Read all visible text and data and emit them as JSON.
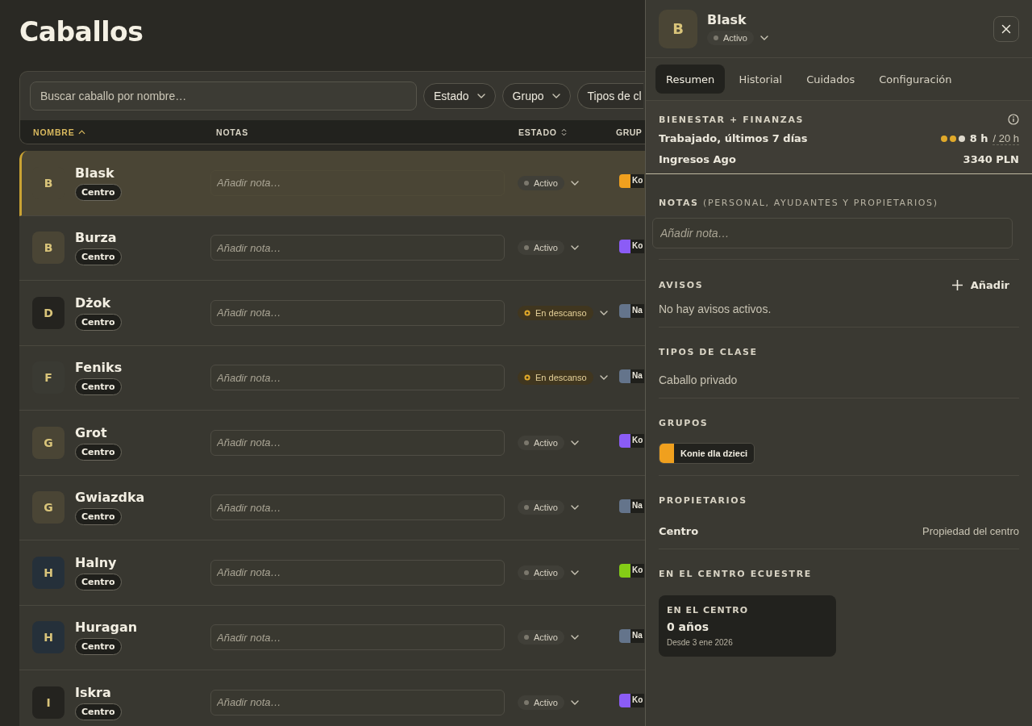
{
  "title": "Caballos",
  "search": {
    "placeholder": "Buscar caballo por nombre…"
  },
  "filters": [
    {
      "label": "Estado",
      "cut": false
    },
    {
      "label": "Grupo",
      "cut": false
    },
    {
      "label": "Tipos de cl",
      "cut": true
    }
  ],
  "columns": [
    {
      "label": "NOMBRE",
      "kind": "sorted"
    },
    {
      "label": "NOTAS",
      "kind": "plain"
    },
    {
      "label": "ESTADO",
      "kind": "sortable"
    },
    {
      "label": "GRUP",
      "kind": "plain"
    }
  ],
  "rows": [
    {
      "avatar": {
        "initial": "B",
        "color": "#4a4535"
      },
      "name": "Blask",
      "tag": "Centro",
      "note_placeholder": "Añadir nota…",
      "status": {
        "label": "Activo",
        "kind": "active"
      },
      "group": {
        "label": "Ko",
        "color": "#f0a01e"
      },
      "selected": true
    },
    {
      "avatar": {
        "initial": "B",
        "color": "#4a4535"
      },
      "name": "Burza",
      "tag": "Centro",
      "note_placeholder": "Añadir nota…",
      "status": {
        "label": "Activo",
        "kind": "active"
      },
      "group": {
        "label": "Ko",
        "color": "#8b5cf6"
      },
      "selected": false
    },
    {
      "avatar": {
        "initial": "D",
        "color": "#24231f"
      },
      "name": "Dżok",
      "tag": "Centro",
      "note_placeholder": "Añadir nota…",
      "status": {
        "label": "En descanso",
        "kind": "resting"
      },
      "group": {
        "label": "Na",
        "color": "#64748b"
      },
      "selected": false
    },
    {
      "avatar": {
        "initial": "F",
        "color": "#3a3a33"
      },
      "name": "Feniks",
      "tag": "Centro",
      "note_placeholder": "Añadir nota…",
      "status": {
        "label": "En descanso",
        "kind": "resting"
      },
      "group": {
        "label": "Na",
        "color": "#64748b"
      },
      "selected": false
    },
    {
      "avatar": {
        "initial": "G",
        "color": "#4a4535"
      },
      "name": "Grot",
      "tag": "Centro",
      "note_placeholder": "Añadir nota…",
      "status": {
        "label": "Activo",
        "kind": "active"
      },
      "group": {
        "label": "Ko",
        "color": "#8b5cf6"
      },
      "selected": false
    },
    {
      "avatar": {
        "initial": "G",
        "color": "#4a4535"
      },
      "name": "Gwiazdka",
      "tag": "Centro",
      "note_placeholder": "Añadir nota…",
      "status": {
        "label": "Activo",
        "kind": "active"
      },
      "group": {
        "label": "Na",
        "color": "#64748b"
      },
      "selected": false
    },
    {
      "avatar": {
        "initial": "H",
        "color": "#25303a"
      },
      "name": "Halny",
      "tag": "Centro",
      "note_placeholder": "Añadir nota…",
      "status": {
        "label": "Activo",
        "kind": "active"
      },
      "group": {
        "label": "Ko",
        "color": "#84cc16"
      },
      "selected": false
    },
    {
      "avatar": {
        "initial": "H",
        "color": "#25303a"
      },
      "name": "Huragan",
      "tag": "Centro",
      "note_placeholder": "Añadir nota…",
      "status": {
        "label": "Activo",
        "kind": "active"
      },
      "group": {
        "label": "Na",
        "color": "#64748b"
      },
      "selected": false
    },
    {
      "avatar": {
        "initial": "I",
        "color": "#24231f"
      },
      "name": "Iskra",
      "tag": "Centro",
      "note_placeholder": "Añadir nota…",
      "status": {
        "label": "Activo",
        "kind": "active"
      },
      "group": {
        "label": "Ko",
        "color": "#8b5cf6"
      },
      "selected": false
    }
  ],
  "panel": {
    "initial": "B",
    "name": "Blask",
    "status": {
      "label": "Activo",
      "kind": "active"
    },
    "tabs": [
      {
        "label": "Resumen",
        "selected": true
      },
      {
        "label": "Historial",
        "selected": false
      },
      {
        "label": "Cuidados",
        "selected": false
      },
      {
        "label": "Configuración",
        "selected": false
      }
    ],
    "wellbeing": {
      "title": "BIENESTAR + FINANZAS",
      "worked_label": "Trabajado, últimos 7 días",
      "stars": 2,
      "worked_value": "8 h",
      "worked_limit": "/ 20 h",
      "income_label": "Ingresos Ago",
      "income_value": "3340 PLN"
    },
    "notes": {
      "title": "NOTAS",
      "subtitle": "(PERSONAL, AYUDANTES Y PROPIETARIOS)",
      "placeholder": "Añadir nota…"
    },
    "alerts": {
      "title": "AVISOS",
      "add_label": "Añadir",
      "empty": "No hay avisos activos."
    },
    "class_types": {
      "title": "TIPOS DE CLASE",
      "value": "Caballo privado"
    },
    "groups": {
      "title": "GRUPOS",
      "items": [
        {
          "label": "Konie dla dzieci",
          "color": "#f0a01e"
        }
      ]
    },
    "owners": {
      "title": "PROPIETARIOS",
      "items": [
        {
          "name": "Centro",
          "detail": "Propiedad del centro"
        }
      ]
    },
    "center": {
      "title": "EN EL CENTRO ECUESTRE",
      "card_title": "EN EL CENTRO",
      "card_value": "0 años",
      "card_since": "Desde 3 ene 2026"
    }
  }
}
